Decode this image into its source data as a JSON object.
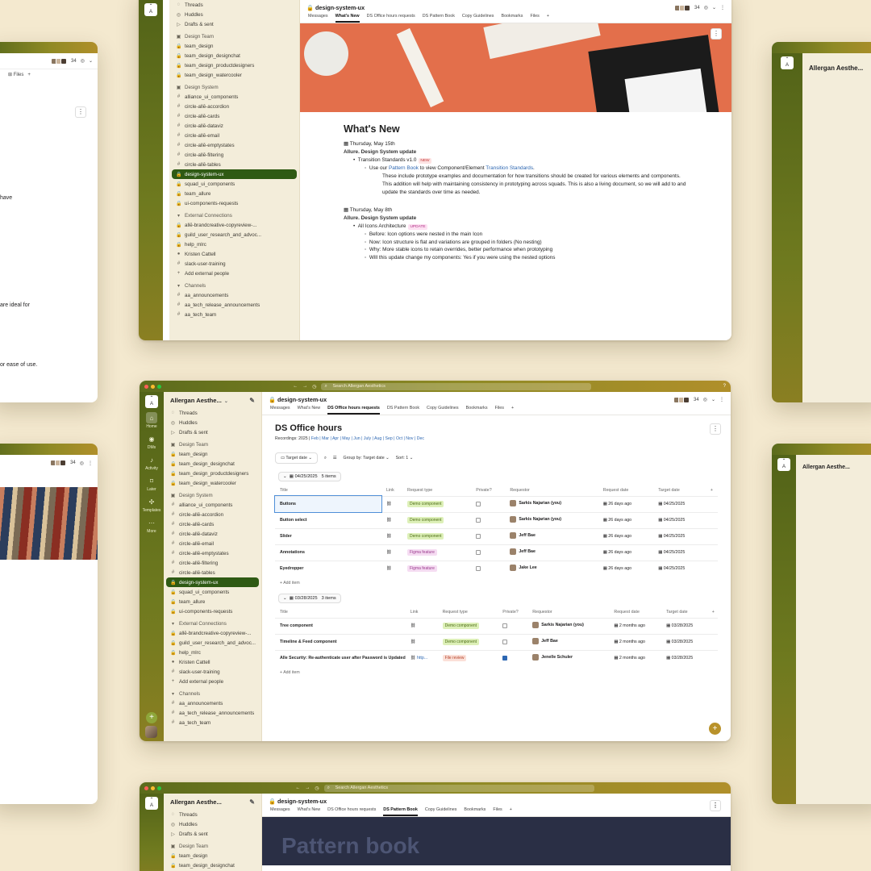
{
  "workspace": "Allergan Aesthe...",
  "channel": "design-system-ux",
  "member_count": "34",
  "rail": [
    {
      "label": "Home",
      "icon": "home-icon"
    },
    {
      "label": "DMs",
      "icon": "dms-icon"
    },
    {
      "label": "Activity",
      "icon": "bell-icon"
    },
    {
      "label": "Later",
      "icon": "bookmark-icon"
    },
    {
      "label": "Templates",
      "icon": "templates-icon"
    },
    {
      "label": "More",
      "icon": "more-icon"
    }
  ],
  "sidebar": [
    {
      "g": "◌",
      "label": "Threads",
      "type": "item"
    },
    {
      "g": "◎",
      "label": "Huddles",
      "type": "item"
    },
    {
      "g": "▷",
      "label": "Drafts & sent",
      "type": "item"
    },
    {
      "g": "▣",
      "label": "Design Team",
      "type": "sec"
    },
    {
      "g": "🔒",
      "label": "team_design",
      "type": "item"
    },
    {
      "g": "🔒",
      "label": "team_design_designchat",
      "type": "item"
    },
    {
      "g": "🔒",
      "label": "team_design_productdesigners",
      "type": "item"
    },
    {
      "g": "🔒",
      "label": "team_design_watercooler",
      "type": "item"
    },
    {
      "g": "▣",
      "label": "Design System",
      "type": "sec"
    },
    {
      "g": "#",
      "label": "alliance_ui_components",
      "type": "item"
    },
    {
      "g": "#",
      "label": "circle-allē-accordion",
      "type": "item"
    },
    {
      "g": "#",
      "label": "circle-allē-cards",
      "type": "item"
    },
    {
      "g": "#",
      "label": "circle-allē-dataviz",
      "type": "item"
    },
    {
      "g": "#",
      "label": "circle-allē-email",
      "type": "item"
    },
    {
      "g": "#",
      "label": "circle-allē-emptystates",
      "type": "item"
    },
    {
      "g": "#",
      "label": "circle-allē-filtering",
      "type": "item"
    },
    {
      "g": "#",
      "label": "circle-allē-tables",
      "type": "item"
    },
    {
      "g": "🔒",
      "label": "design-system-ux",
      "type": "sel"
    },
    {
      "g": "🔒",
      "label": "squad_ui_components",
      "type": "item"
    },
    {
      "g": "🔒",
      "label": "team_allure",
      "type": "item"
    },
    {
      "g": "🔒",
      "label": "ui-components-requests",
      "type": "item"
    },
    {
      "g": "▾",
      "label": "External Connections",
      "type": "sec"
    },
    {
      "g": "🔒",
      "label": "allē-brandcreative-copyreview-...",
      "type": "item"
    },
    {
      "g": "🔒",
      "label": "guild_user_research_and_advoc...",
      "type": "item"
    },
    {
      "g": "🔒",
      "label": "help_mlrc",
      "type": "item"
    },
    {
      "g": "●",
      "label": "Kristen Cattell",
      "type": "item"
    },
    {
      "g": "#",
      "label": "slack-user-training",
      "type": "item"
    },
    {
      "g": "+",
      "label": "Add external people",
      "type": "item"
    },
    {
      "g": "▾",
      "label": "Channels",
      "type": "sec"
    },
    {
      "g": "#",
      "label": "aa_announcements",
      "type": "item"
    },
    {
      "g": "#",
      "label": "aa_tech_release_announcements",
      "type": "item"
    },
    {
      "g": "#",
      "label": "aa_tech_team",
      "type": "item"
    }
  ],
  "tabs": [
    "Messages",
    "What's New",
    "DS Office hours requests",
    "DS Pattern Book",
    "Copy Guidelines",
    "Bookmarks",
    "Files"
  ],
  "search_placeholder": "Search Allergan Aesthetics",
  "office": {
    "title": "DS Office hours",
    "recordings_label": "Recordings: 2025 | ",
    "months": "Feb | Mar | Apr | May | Jun | July | Aug | Sep | Oct | Nov | Dec",
    "target_date": "Target date",
    "group_by": "Group by: Target date",
    "sort": "Sort: 1",
    "columns": [
      "Title",
      "Link",
      "Request type",
      "Private?",
      "Requestor",
      "Request date",
      "Target date"
    ],
    "groups": [
      {
        "date": "04/25/2025",
        "count": "5 items",
        "rows": [
          {
            "title": "Buttons",
            "type": "Demo component",
            "tag": "demo",
            "private": false,
            "requestor": "Sarkis Najarian (you)",
            "req": "26 days ago",
            "target": "04/25/2025"
          },
          {
            "title": "Button select",
            "type": "Demo component",
            "tag": "demo",
            "private": false,
            "requestor": "Sarkis Najarian (you)",
            "req": "26 days ago",
            "target": "04/25/2025"
          },
          {
            "title": "Slider",
            "type": "Demo component",
            "tag": "demo",
            "private": false,
            "requestor": "Jeff Bae",
            "req": "26 days ago",
            "target": "04/25/2025"
          },
          {
            "title": "Annotations",
            "type": "Figma feature",
            "tag": "figma",
            "private": false,
            "requestor": "Jeff Bae",
            "req": "26 days ago",
            "target": "04/25/2025"
          },
          {
            "title": "Eyedropper",
            "type": "Figma feature",
            "tag": "figma",
            "private": false,
            "requestor": "Jake Lee",
            "req": "26 days ago",
            "target": "04/25/2025"
          }
        ]
      },
      {
        "date": "03/28/2025",
        "count": "3 items",
        "rows": [
          {
            "title": "Tree component",
            "type": "Demo component",
            "tag": "demo",
            "private": false,
            "requestor": "Sarkis Najarian (you)",
            "req": "2 months ago",
            "target": "03/28/2025"
          },
          {
            "title": "Timeline & Feed component",
            "type": "Demo component",
            "tag": "demo",
            "private": false,
            "requestor": "Jeff Bae",
            "req": "2 months ago",
            "target": "03/28/2025"
          },
          {
            "title": "Alle Security: Re-authenticate user after Password is Updated",
            "type": "File review",
            "tag": "file",
            "private": true,
            "requestor": "Jenelle Schuler",
            "req": "2 months ago",
            "target": "03/28/2025",
            "link": "http..."
          }
        ]
      }
    ],
    "add_item": "Add item"
  },
  "whatsnew": {
    "title": "What's New",
    "date1": "Thursday, May 15th",
    "update1": "Allure. Design System update",
    "bullet1": "Transition Standards v1.0",
    "badge1": "NEW",
    "sub1a": "Use our ",
    "sub1link": "Pattern Book",
    "sub1b": " to view Component/Element ",
    "sub1link2": "Transition Standards",
    "sub1c": ".",
    "sub1detail": "These include prototype examples and documentation for how transitions should be created for various elements and components. This addition will help with maintaining consistency in prototyping across squads. This is also a living document, so we will add to and update the standards over time as needed.",
    "date2": "Thursday, May 8th",
    "update2": "Allure. Design System update",
    "bullet2": "All Icons Architecture",
    "badge2": "UPDATE",
    "items2": [
      "Before: Icon options were nested in the main Icon",
      "Now: Icon structure is flat and variations are grouped in folders (No nesting)",
      "Why: More stable icons to retain overrides, better performance when prototyping",
      "Will this update change my components: Yes if you were using the nested options"
    ]
  },
  "patternbook": {
    "title": "Pattern book"
  },
  "left_fragments": [
    "have",
    "are ideal for",
    "or ease of use."
  ]
}
